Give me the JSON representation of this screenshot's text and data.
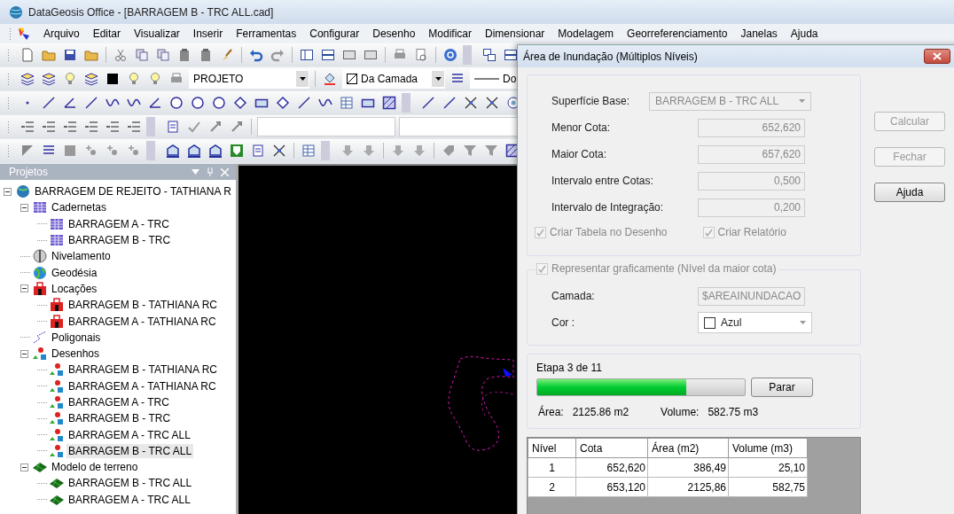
{
  "window": {
    "title": "DataGeosis Office - [BARRAGEM B - TRC ALL.cad]"
  },
  "menu": [
    "Arquivo",
    "Editar",
    "Visualizar",
    "Inserir",
    "Ferramentas",
    "Configurar",
    "Desenho",
    "Modificar",
    "Dimensionar",
    "Modelagem",
    "Georreferenciamento",
    "Janelas",
    "Ajuda"
  ],
  "toolbar": {
    "layer": "PROJETO",
    "color_mode": "Da Camada",
    "linetype": "Do"
  },
  "projects_panel": {
    "title": "Projetos",
    "tree": [
      {
        "label": "BARRAGEM DE REJEITO - TATHIANA R",
        "kind": "project",
        "expanded": true,
        "selected": false,
        "children": [
          {
            "label": "Cadernetas",
            "kind": "notebook",
            "expanded": true,
            "selected": false,
            "children": [
              {
                "label": "BARRAGEM A - TRC",
                "kind": "notebook",
                "selected": false
              },
              {
                "label": "BARRAGEM B - TRC",
                "kind": "notebook",
                "selected": false
              }
            ]
          },
          {
            "label": "Nivelamento",
            "kind": "leveling",
            "selected": false
          },
          {
            "label": "Geodésia",
            "kind": "geodesy",
            "selected": false
          },
          {
            "label": "Locações",
            "kind": "stakeout",
            "expanded": true,
            "selected": false,
            "children": [
              {
                "label": "BARRAGEM B - TATHIANA RC",
                "kind": "stakeout",
                "selected": false
              },
              {
                "label": "BARRAGEM A - TATHIANA RC",
                "kind": "stakeout",
                "selected": false
              }
            ]
          },
          {
            "label": "Poligonais",
            "kind": "traverse",
            "selected": false
          },
          {
            "label": "Desenhos",
            "kind": "drawing",
            "expanded": true,
            "selected": false,
            "children": [
              {
                "label": "BARRAGEM B - TATHIANA RC",
                "kind": "drawing",
                "selected": false
              },
              {
                "label": "BARRAGEM A - TATHIANA RC",
                "kind": "drawing",
                "selected": false
              },
              {
                "label": "BARRAGEM A - TRC",
                "kind": "drawing",
                "selected": false
              },
              {
                "label": "BARRAGEM B - TRC",
                "kind": "drawing",
                "selected": false
              },
              {
                "label": "BARRAGEM A - TRC ALL",
                "kind": "drawing",
                "selected": false
              },
              {
                "label": "BARRAGEM B - TRC ALL",
                "kind": "drawing",
                "selected": true
              }
            ]
          },
          {
            "label": "Modelo de terreno",
            "kind": "terrain",
            "expanded": true,
            "selected": false,
            "children": [
              {
                "label": "BARRAGEM B - TRC ALL",
                "kind": "terrain",
                "selected": false
              },
              {
                "label": "BARRAGEM A - TRC ALL",
                "kind": "terrain",
                "selected": false
              }
            ]
          }
        ]
      }
    ]
  },
  "dialog": {
    "title": "Área de Inundação (Múltiplos Níveis)",
    "base_surface": {
      "label": "Superfície Base:",
      "value": "BARRAGEM B - TRC ALL",
      "disabled": true
    },
    "fields": [
      {
        "label": "Menor Cota:",
        "value": "652,620",
        "disabled": true
      },
      {
        "label": "Maior Cota:",
        "value": "657,620",
        "disabled": true
      },
      {
        "label": "Intervalo entre Cotas:",
        "value": "0,500",
        "disabled": true
      },
      {
        "label": "Intervalo de Integração:",
        "value": "0,200",
        "disabled": true
      }
    ],
    "checkboxes": [
      {
        "label": "Criar Tabela no Desenho",
        "checked": true,
        "disabled": true
      },
      {
        "label": "Criar Relatório",
        "checked": true,
        "disabled": true
      }
    ],
    "graphic": {
      "label": "Representar graficamente (Nível da maior cota)",
      "checked": true,
      "disabled": true,
      "layer": {
        "label": "Camada:",
        "value": "$AREAINUNDACAO"
      },
      "color": {
        "label": "Cor :",
        "value": "Azul"
      }
    },
    "progress": {
      "label": "Etapa 3 de 11",
      "level": 0.72,
      "stop_button": "Parar",
      "area_label": "Área:",
      "area": "2125.86 m2",
      "volume_label": "Volume:",
      "volume": "582.75 m3"
    },
    "table": {
      "columns": [
        "Nível",
        "Cota",
        "Área (m2)",
        "Volume (m3)"
      ],
      "rows": [
        [
          "1",
          "652,620",
          "386,49",
          "25,10"
        ],
        [
          "2",
          "653,120",
          "2125,86",
          "582,75"
        ]
      ]
    },
    "buttons": [
      {
        "label": "Calcular",
        "disabled": true
      },
      {
        "label": "Fechar",
        "disabled": true
      },
      {
        "label": "Ajuda",
        "disabled": false
      }
    ]
  }
}
